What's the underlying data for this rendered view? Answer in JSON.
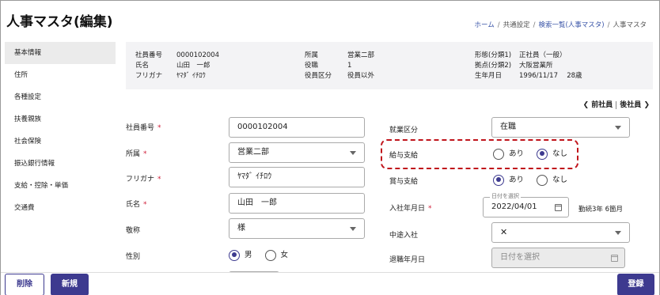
{
  "header": {
    "title": "人事マスタ(編集)",
    "breadcrumb": [
      "ホーム",
      "共通設定",
      "検索一覧(人事マスタ)",
      "人事マスタ"
    ]
  },
  "sidebar": {
    "items": [
      {
        "label": "基本情報",
        "active": true
      },
      {
        "label": "住所"
      },
      {
        "label": "各種設定"
      },
      {
        "label": "扶養親族"
      },
      {
        "label": "社会保険"
      },
      {
        "label": "振込銀行情報"
      },
      {
        "label": "支給・控除・単価"
      },
      {
        "label": "交通費"
      }
    ]
  },
  "summary": {
    "col1": [
      {
        "key": "社員番号",
        "value": "0000102004"
      },
      {
        "key": "氏名",
        "value": "山田　一郎"
      },
      {
        "key": "フリガナ",
        "value": "ﾔﾏﾀﾞ ｲﾁﾛｳ"
      }
    ],
    "col2": [
      {
        "key": "所属",
        "value": "営業二部"
      },
      {
        "key": "役職",
        "value": "1"
      },
      {
        "key": "役員区分",
        "value": "役員以外"
      }
    ],
    "col3": [
      {
        "key": "形態(分類1)",
        "value": "正社員（一般）"
      },
      {
        "key": "拠点(分類2)",
        "value": "大阪営業所"
      },
      {
        "key": "生年月日",
        "value": "1996/11/17　 28歳"
      }
    ]
  },
  "nav": {
    "prev": "前社員",
    "next": "後社員"
  },
  "form": {
    "employee_no": {
      "label": "社員番号",
      "value": "0000102004"
    },
    "department": {
      "label": "所属",
      "value": "営業二部"
    },
    "furigana": {
      "label": "フリガナ",
      "value": "ﾔﾏﾀﾞ ｲﾁﾛｳ"
    },
    "name": {
      "label": "氏名",
      "value": "山田　一郎"
    },
    "honorific": {
      "label": "敬称",
      "value": "様"
    },
    "gender": {
      "label": "性別",
      "options": [
        "男",
        "女"
      ],
      "selected": "男"
    },
    "employment_status": {
      "label": "就業区分",
      "value": "在職"
    },
    "salary_payment": {
      "label": "給与支給",
      "options": [
        "あり",
        "なし"
      ],
      "selected": "なし"
    },
    "bonus_payment": {
      "label": "賞与支給",
      "options": [
        "あり",
        "なし"
      ],
      "selected": "あり"
    },
    "hire_date": {
      "label": "入社年月日",
      "float_label": "日付を選択",
      "value": "2022/04/01",
      "tenure": "勤続3年 6箇月"
    },
    "mid_career": {
      "label": "中途入社",
      "value": "✕"
    },
    "retire_date": {
      "label": "退職年月日",
      "placeholder": "日付を選択"
    }
  },
  "footer": {
    "delete": "削除",
    "new": "新規",
    "save": "登録"
  },
  "colors": {
    "accent": "#3d3a8f",
    "required": "#d0213b",
    "highlight": "#c0141b"
  }
}
